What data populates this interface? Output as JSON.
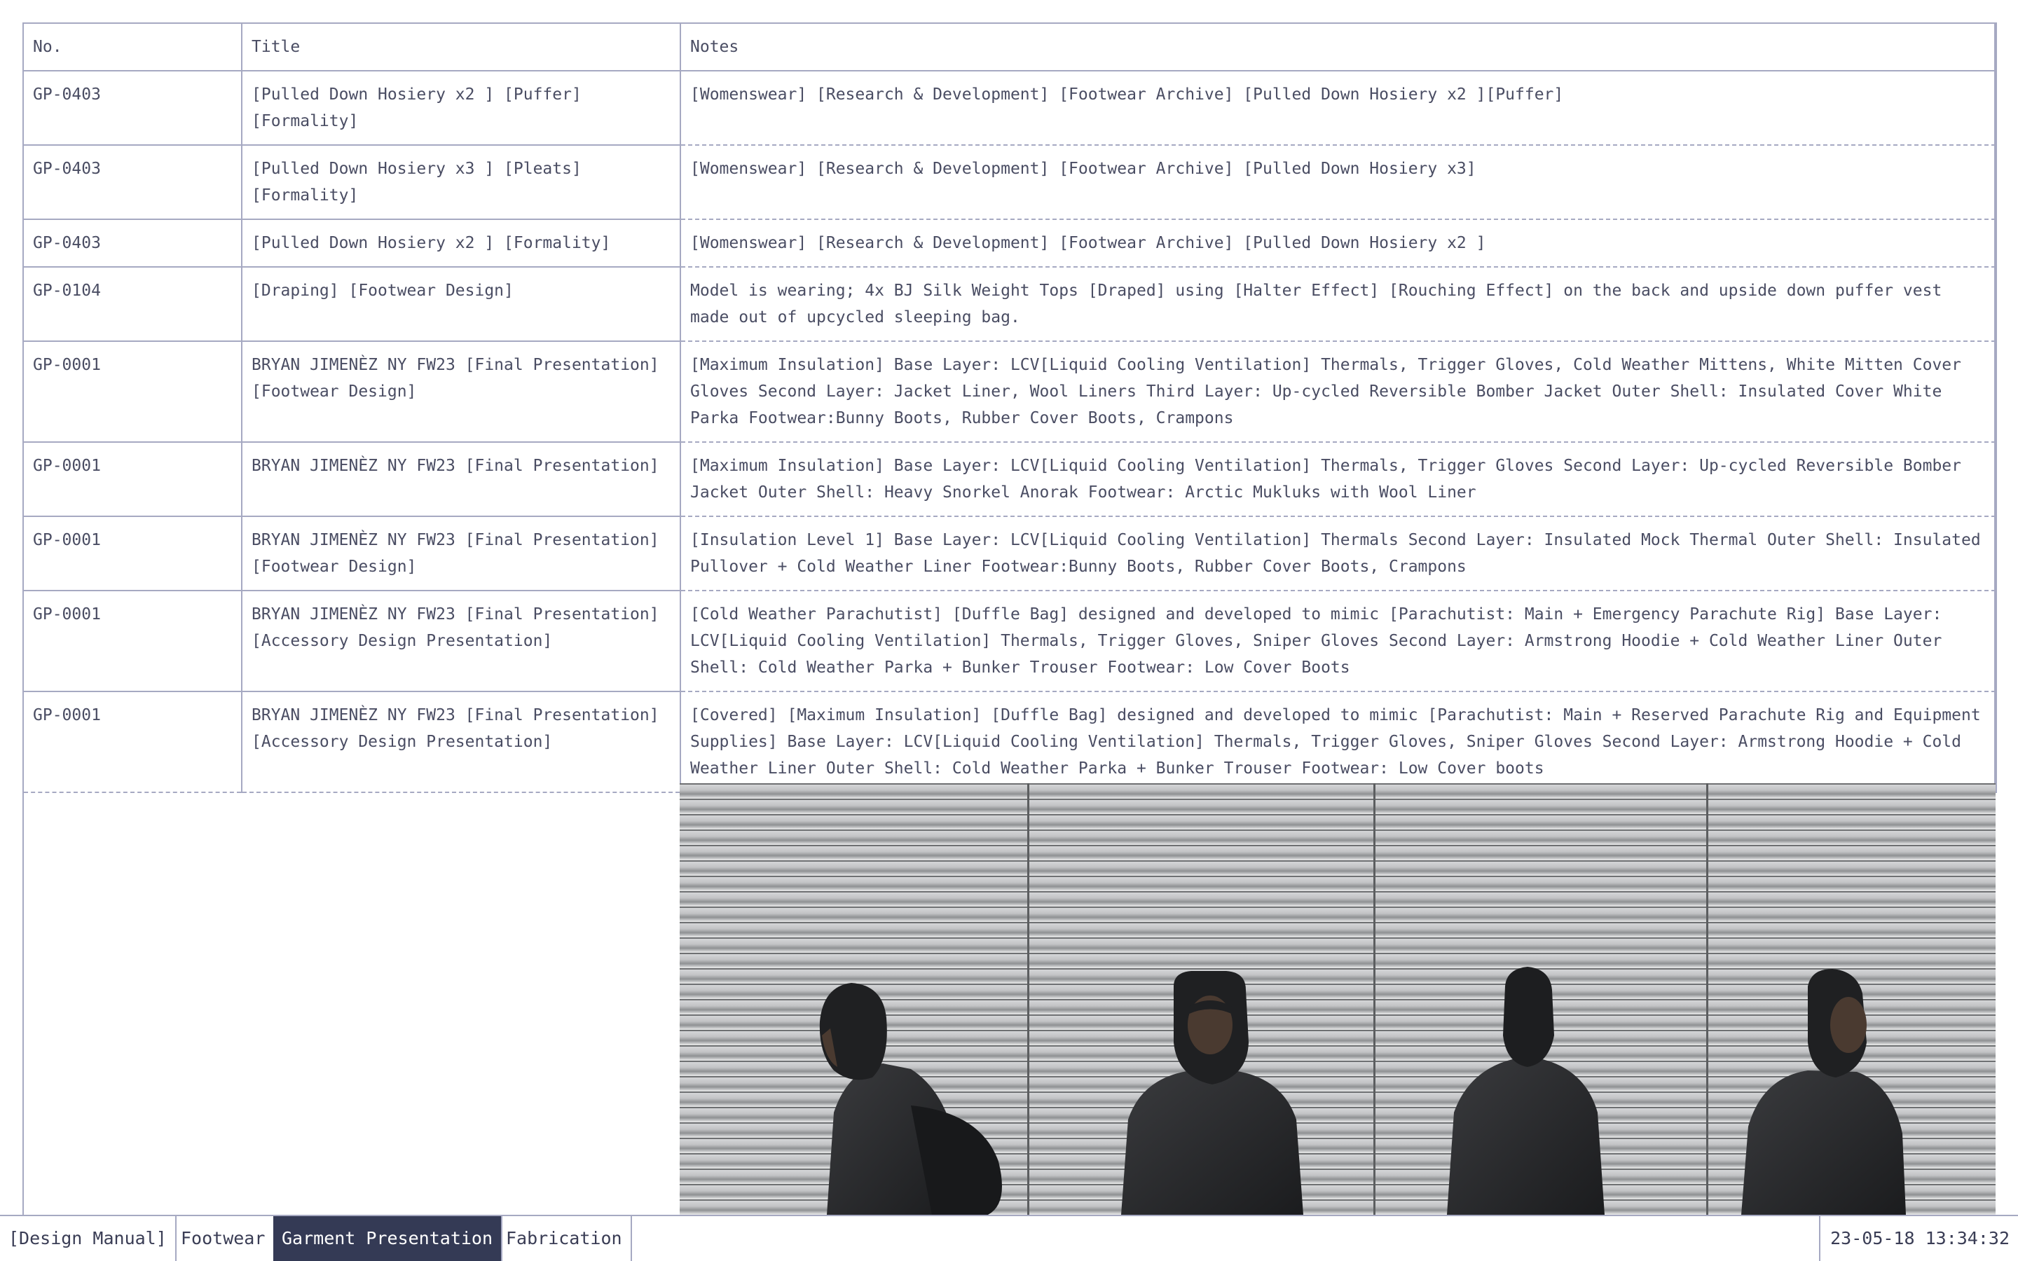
{
  "table": {
    "headers": {
      "no": "No.",
      "title": "Title",
      "notes": "Notes"
    },
    "rows": [
      {
        "no": "GP-0403",
        "title": "[Pulled Down Hosiery x2 ] [Puffer] [Formality]",
        "notes": "[Womenswear] [Research & Development] [Footwear Archive] [Pulled Down Hosiery x2 ][Puffer]"
      },
      {
        "no": "GP-0403",
        "title": "[Pulled Down Hosiery x3 ] [Pleats] [Formality]",
        "notes": "[Womenswear] [Research & Development] [Footwear Archive] [Pulled Down Hosiery x3]"
      },
      {
        "no": "GP-0403",
        "title": "[Pulled Down Hosiery x2 ] [Formality]",
        "notes": "[Womenswear] [Research & Development] [Footwear Archive] [Pulled Down Hosiery x2 ]"
      },
      {
        "no": "GP-0104",
        "title": "[Draping] [Footwear Design]",
        "notes": "Model is wearing; 4x BJ Silk Weight Tops [Draped] using [Halter Effect] [Rouching Effect] on the back and upside down puffer vest made out of upcycled sleeping bag."
      },
      {
        "no": "GP-0001",
        "title": "BRYAN JIMENÈZ NY FW23 [Final Presentation] [Footwear Design]",
        "notes": "[Maximum Insulation] Base Layer: LCV[Liquid Cooling Ventilation] Thermals, Trigger Gloves, Cold Weather Mittens, White Mitten Cover Gloves Second Layer: Jacket Liner, Wool Liners Third Layer: Up-cycled Reversible Bomber Jacket Outer Shell: Insulated Cover White Parka Footwear:Bunny Boots, Rubber Cover Boots, Crampons"
      },
      {
        "no": "GP-0001",
        "title": "BRYAN JIMENÈZ NY FW23 [Final Presentation]",
        "notes": "[Maximum Insulation] Base Layer: LCV[Liquid Cooling Ventilation] Thermals, Trigger Gloves Second Layer: Up-cycled Reversible Bomber Jacket Outer Shell: Heavy Snorkel Anorak Footwear: Arctic Mukluks with Wool Liner"
      },
      {
        "no": "GP-0001",
        "title": "BRYAN JIMENÈZ NY FW23 [Final Presentation] [Footwear Design]",
        "notes": "[Insulation Level 1] Base Layer: LCV[Liquid Cooling Ventilation] Thermals Second Layer: Insulated Mock Thermal Outer Shell: Insulated Pullover + Cold Weather Liner Footwear:Bunny Boots, Rubber Cover Boots, Crampons"
      },
      {
        "no": "GP-0001",
        "title": "BRYAN JIMENÈZ NY FW23 [Final Presentation] [Accessory Design Presentation]",
        "notes": "[Cold Weather Parachutist] [Duffle Bag] designed and developed to mimic [Parachutist: Main + Emergency Parachute Rig] Base Layer: LCV[Liquid Cooling Ventilation] Thermals, Trigger Gloves, Sniper Gloves Second Layer: Armstrong Hoodie + Cold Weather Liner Outer Shell: Cold Weather Parka + Bunker Trouser Footwear: Low Cover Boots"
      },
      {
        "no": "GP-0001",
        "title": "BRYAN JIMENÈZ NY FW23 [Final Presentation] [Accessory Design Presentation]",
        "notes": "[Covered] [Maximum Insulation] [Duffle Bag] designed and developed to mimic [Parachutist: Main + Reserved Parachute Rig and Equipment Supplies] Base Layer: LCV[Liquid Cooling Ventilation] Thermals, Trigger Gloves, Sniper Gloves Second Layer: Armstrong Hoodie + Cold Weather Liner Outer Shell: Cold Weather Parka + Bunker Trouser Footwear: Low Cover boots"
      }
    ]
  },
  "photo": {
    "panels": [
      "side-left",
      "front",
      "back",
      "side-right"
    ]
  },
  "taskbar": {
    "tabs": [
      {
        "label": "[Design Manual]",
        "active": false
      },
      {
        "label": "Footwear",
        "active": false
      },
      {
        "label": "Garment Presentation",
        "active": true
      },
      {
        "label": "Fabrication",
        "active": false
      }
    ],
    "clock": "23-05-18 13:34:32"
  },
  "colors": {
    "border": "#a6a9c2",
    "text": "#4a4d63",
    "active_tab_bg": "#343a55",
    "active_tab_text": "#ffffff"
  }
}
